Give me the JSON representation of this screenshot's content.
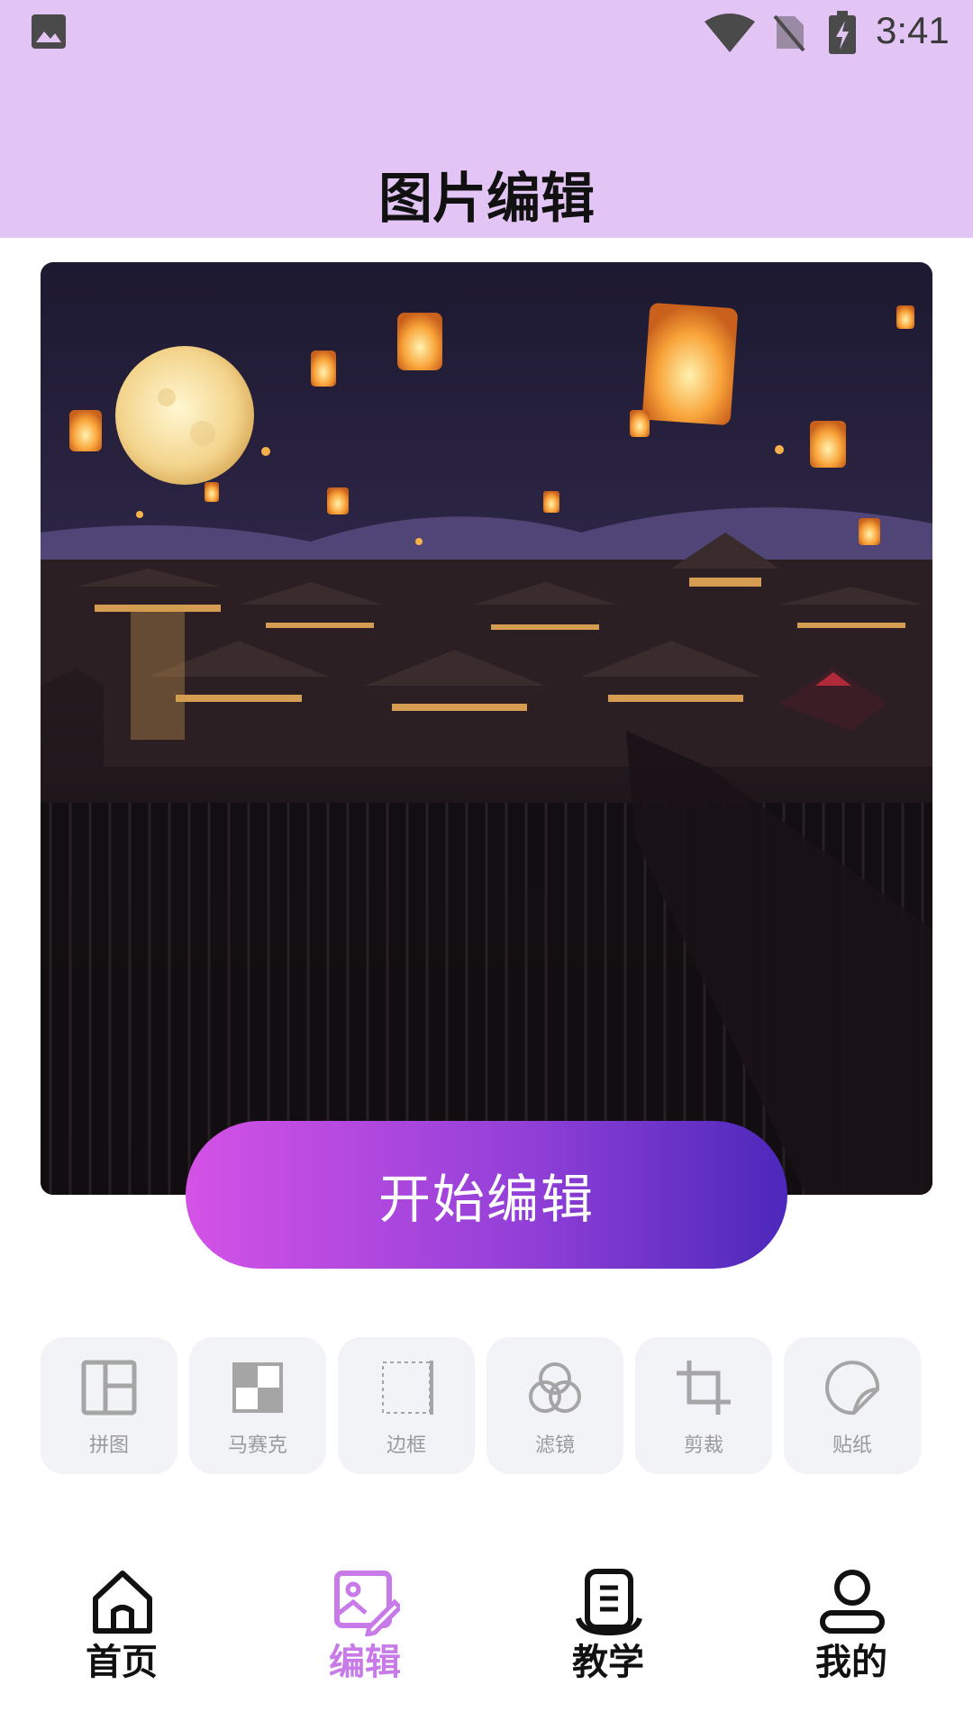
{
  "status_bar": {
    "time": "3:41",
    "icons": [
      "image-icon",
      "wifi-icon",
      "no-sim-icon",
      "battery-charging-icon"
    ]
  },
  "header": {
    "title": "图片编辑"
  },
  "hero": {
    "image": "lantern-night-city-illustration"
  },
  "main": {
    "start_button": "开始编辑"
  },
  "tools": [
    {
      "label": "拼图",
      "icon": "collage-icon"
    },
    {
      "label": "马赛克",
      "icon": "mosaic-icon"
    },
    {
      "label": "边框",
      "icon": "border-icon"
    },
    {
      "label": "滤镜",
      "icon": "filter-icon"
    },
    {
      "label": "剪裁",
      "icon": "crop-icon"
    },
    {
      "label": "贴纸",
      "icon": "sticker-icon"
    }
  ],
  "nav": {
    "active": "编辑",
    "items": [
      {
        "label": "首页",
        "icon": "home-icon"
      },
      {
        "label": "编辑",
        "icon": "edit-image-icon"
      },
      {
        "label": "教学",
        "icon": "tutorial-icon"
      },
      {
        "label": "我的",
        "icon": "profile-icon"
      }
    ]
  },
  "colors": {
    "header_bg": "#e2c5f5",
    "accent": "#c77ae8",
    "button_start": "#d452e6",
    "button_end": "#4c28bb",
    "tool_bg": "#f2f3f6"
  }
}
